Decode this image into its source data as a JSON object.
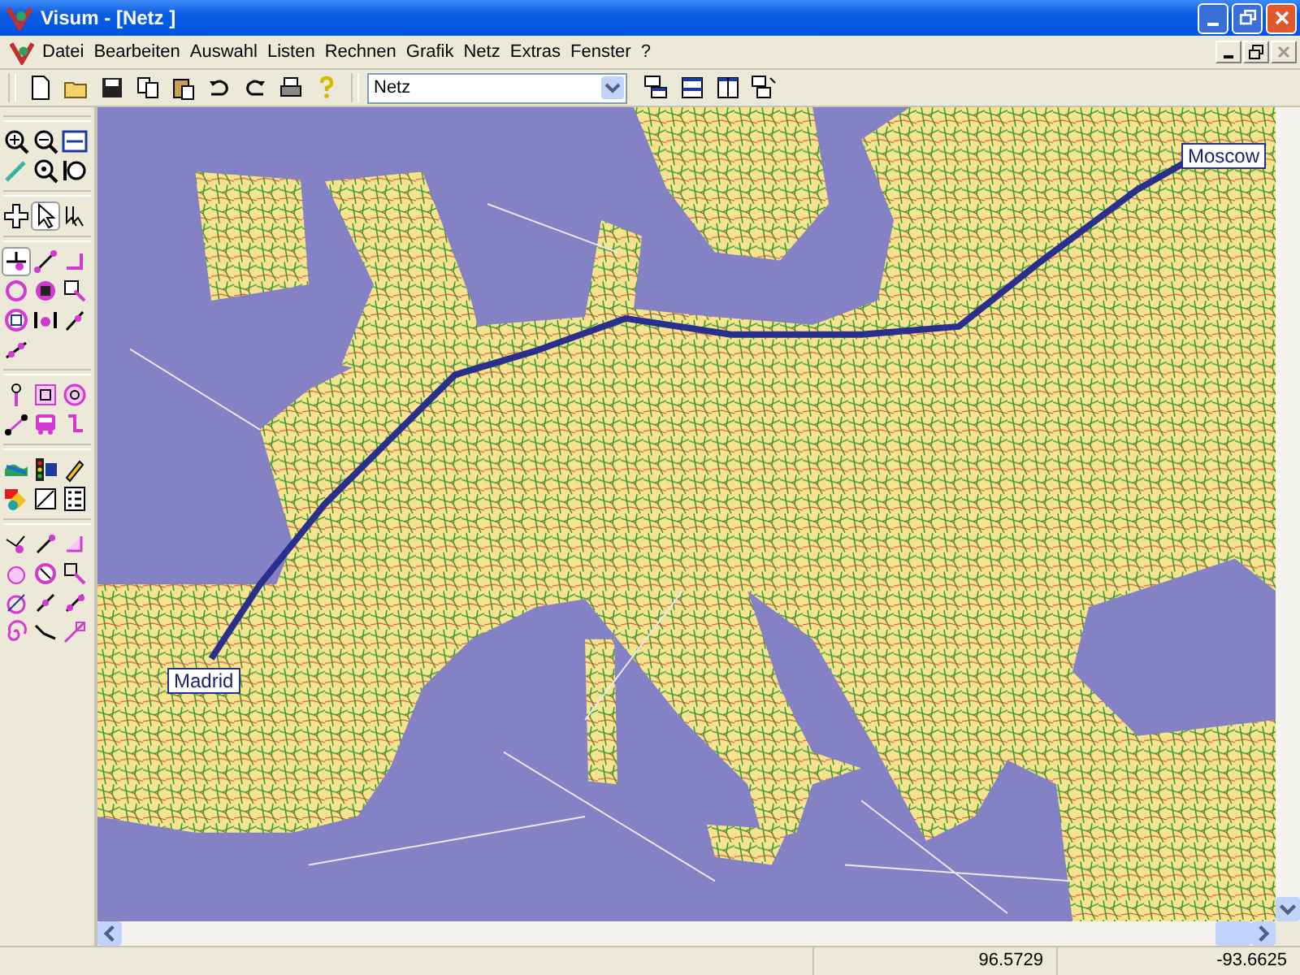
{
  "window": {
    "title": "Visum - [Netz ]"
  },
  "menu": [
    {
      "label": "Datei"
    },
    {
      "label": "Bearbeiten"
    },
    {
      "label": "Auswahl"
    },
    {
      "label": "Listen"
    },
    {
      "label": "Rechnen"
    },
    {
      "label": "Grafik"
    },
    {
      "label": "Netz"
    },
    {
      "label": "Extras"
    },
    {
      "label": "Fenster"
    },
    {
      "label": "?"
    }
  ],
  "toolbar": {
    "view_select": {
      "value": "Netz"
    }
  },
  "map": {
    "labels": [
      {
        "text": "Madrid",
        "kind": "start"
      },
      {
        "text": "Moscow",
        "kind": "end"
      }
    ]
  },
  "status_bar": {
    "fields": [
      "96.5729",
      "-93.6625"
    ]
  }
}
